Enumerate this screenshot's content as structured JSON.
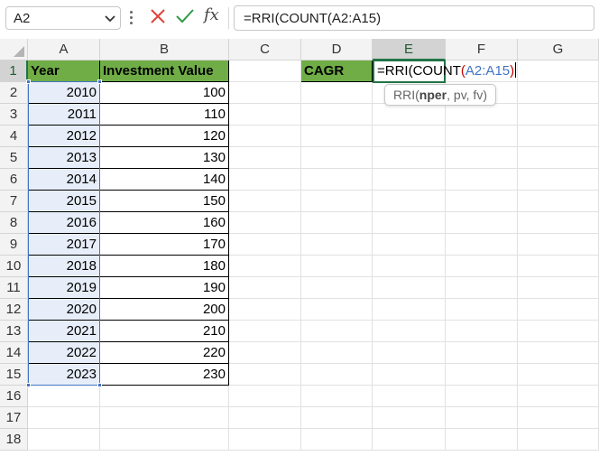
{
  "formula_bar": {
    "name_box": "A2",
    "cancel_icon": "close-icon",
    "enter_icon": "check-icon",
    "function_label": "fx",
    "formula": "=RRI(COUNT(A2:A15)"
  },
  "columns": [
    "A",
    "B",
    "C",
    "D",
    "E",
    "F",
    "G"
  ],
  "rows": [
    "1",
    "2",
    "3",
    "4",
    "5",
    "6",
    "7",
    "8",
    "9",
    "10",
    "11",
    "12",
    "13",
    "14",
    "15",
    "16",
    "17",
    "18"
  ],
  "table": {
    "headers": {
      "year": "Year",
      "value": "Investment Value"
    },
    "data": [
      {
        "year": "2010",
        "value": "100"
      },
      {
        "year": "2011",
        "value": "110"
      },
      {
        "year": "2012",
        "value": "120"
      },
      {
        "year": "2013",
        "value": "130"
      },
      {
        "year": "2014",
        "value": "140"
      },
      {
        "year": "2015",
        "value": "150"
      },
      {
        "year": "2016",
        "value": "160"
      },
      {
        "year": "2017",
        "value": "170"
      },
      {
        "year": "2018",
        "value": "180"
      },
      {
        "year": "2019",
        "value": "190"
      },
      {
        "year": "2020",
        "value": "200"
      },
      {
        "year": "2021",
        "value": "210"
      },
      {
        "year": "2022",
        "value": "220"
      },
      {
        "year": "2023",
        "value": "230"
      }
    ]
  },
  "cagr_label": "CAGR",
  "edit_cell": {
    "prefix": "=RRI(COUNT",
    "open_paren": "(",
    "reference": "A2:A15",
    "close_paren": ")"
  },
  "tooltip": {
    "func": "RRI(",
    "arg1": "nper",
    "rest": ", pv, fv)"
  },
  "colors": {
    "header_fill": "#70ad47",
    "selection_fill": "#e7eef9",
    "reference_blue": "#4472c4",
    "active_green": "#217346"
  }
}
